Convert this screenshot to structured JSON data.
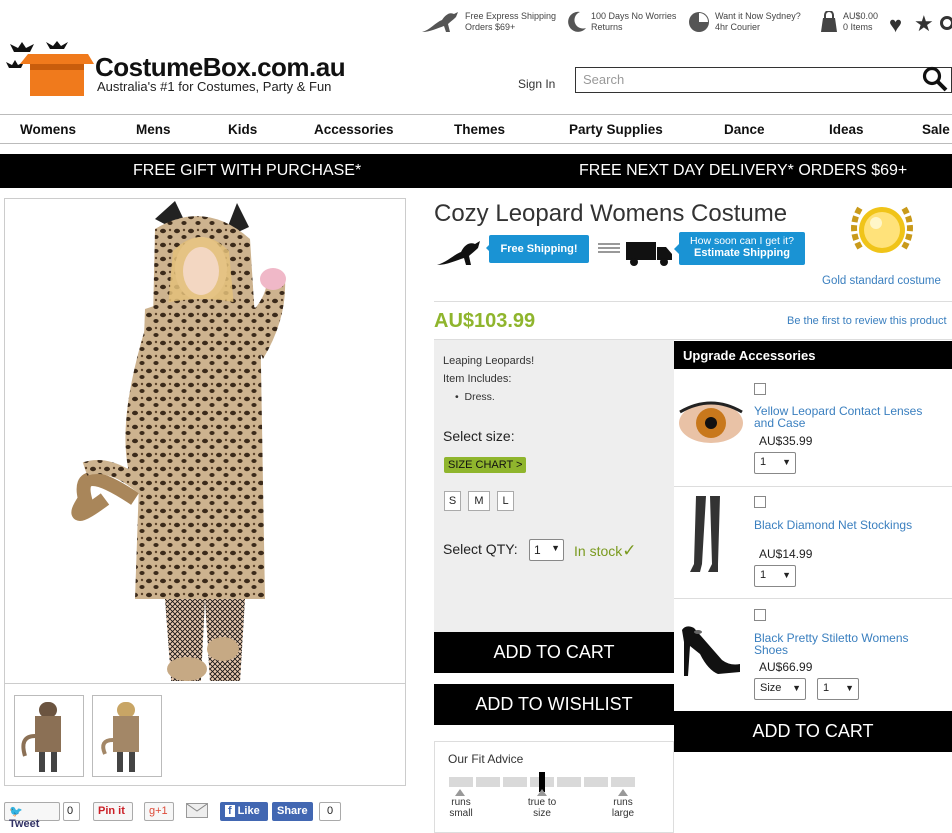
{
  "header": {
    "logo_title": "CostumeBox.com.au",
    "logo_tagline": "Australia's #1 for Costumes, Party & Fun",
    "promos": [
      {
        "line1": "Free Express Shipping",
        "line2": "Orders $69+"
      },
      {
        "line1": "100 Days No Worries",
        "line2": "Returns"
      },
      {
        "line1": "Want it Now Sydney?",
        "line2": "4hr Courier"
      }
    ],
    "cart_total": "AU$0.00",
    "cart_items": "0 Items",
    "sign_in": "Sign In",
    "search_placeholder": "Search"
  },
  "nav": [
    "Womens",
    "Mens",
    "Kids",
    "Accessories",
    "Themes",
    "Party Supplies",
    "Dance",
    "Ideas",
    "Sale"
  ],
  "banner": {
    "left": "FREE GIFT WITH PURCHASE*",
    "right": "FREE NEXT DAY DELIVERY* ORDERS $69+"
  },
  "product": {
    "title": "Cozy Leopard Womens Costume",
    "free_shipping": "Free Shipping!",
    "estimate_line1": "How soon can I get it?",
    "estimate_line2": "Estimate Shipping",
    "gold_label": "Gold standard costume",
    "price": "AU$103.99",
    "review_link": "Be the first to review this product",
    "description": "Leaping Leopards!",
    "includes_label": "Item Includes:",
    "includes": [
      "Dress."
    ],
    "select_size_label": "Select size:",
    "size_chart": "SIZE CHART >",
    "sizes": [
      "S",
      "M",
      "L"
    ],
    "qty_label": "Select QTY:",
    "qty_value": "1",
    "stock": "In stock",
    "add_to_cart": "ADD TO CART",
    "add_to_wishlist": "ADD TO WISHLIST"
  },
  "fit": {
    "title": "Our Fit Advice",
    "labels": [
      {
        "line1": "runs",
        "line2": "small"
      },
      {
        "line1": "true to",
        "line2": "size"
      },
      {
        "line1": "runs",
        "line2": "large"
      }
    ],
    "level": 0.5
  },
  "upgrade": {
    "title": "Upgrade Accessories",
    "items": [
      {
        "name": "Yellow Leopard Contact Lenses and Case",
        "price": "AU$35.99",
        "qty": "1"
      },
      {
        "name": "Black Diamond Net Stockings",
        "price": "AU$14.99",
        "qty": "1"
      },
      {
        "name": "Black Pretty Stiletto Womens Shoes",
        "price": "AU$66.99",
        "size": "Size",
        "qty": "1"
      }
    ],
    "add_to_cart": "ADD TO CART"
  },
  "social": {
    "tweet": "Tweet",
    "tweet_count": "0",
    "pinit": "Pin it",
    "gplus": "g+1",
    "like": "Like",
    "share": "Share",
    "fb_count": "0"
  },
  "colors": {
    "accent_green": "#8fb52d",
    "link_blue": "#3a7fbf",
    "button_blue": "#1a93d4",
    "logo_orange": "#f07a1c"
  }
}
